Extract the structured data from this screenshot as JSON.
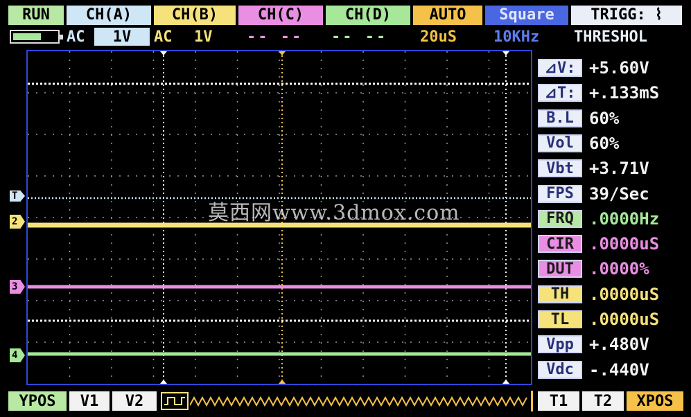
{
  "header": {
    "run": "RUN",
    "ch_a": "CH(A)",
    "ch_b": "CH(B)",
    "ch_c": "CH(C)",
    "ch_d": "CH(D)",
    "mode": "AUTO",
    "waveform": "Square",
    "trigger": "TRIGG: ⌇"
  },
  "subheader": {
    "ch_a_coupling": "AC",
    "ch_a_scale": "1V",
    "ch_b_coupling": "AC",
    "ch_b_scale": "1V",
    "ch_c_value": "-- --",
    "ch_d_value": "-- --",
    "timebase": "20uS",
    "frequency": "10KHz",
    "trigger_mode": "THRESHOL",
    "battery_level": 0.65
  },
  "measurements": [
    {
      "label": "⊿V:",
      "value": "+5.60V"
    },
    {
      "label": "⊿T:",
      "value": "+.133mS"
    },
    {
      "label": "B.L",
      "value": "60%"
    },
    {
      "label": "Vol",
      "value": "60%"
    },
    {
      "label": "Vbt",
      "value": "+3.71V"
    },
    {
      "label": "FPS",
      "value": "39/Sec"
    },
    {
      "label": "FRQ",
      "value": ".0000Hz"
    },
    {
      "label": "CIR",
      "value": ".0000uS"
    },
    {
      "label": "DUT",
      "value": ".0000%"
    },
    {
      "label": "TH",
      "value": ".0000uS"
    },
    {
      "label": "TL",
      "value": ".0000uS"
    },
    {
      "label": "Vpp",
      "value": "+.480V"
    },
    {
      "label": "Vdc",
      "value": "-.440V"
    }
  ],
  "markers": {
    "trigger": "T",
    "ch2": "2",
    "ch3": "3",
    "ch4": "4"
  },
  "footer": {
    "ypos": "YPOS",
    "v1": "V1",
    "v2": "V2",
    "t1": "T1",
    "t2": "T2",
    "xpos": "XPOS"
  },
  "watermark": "莫西网www.3dmox.com",
  "colors": {
    "ch_a": "#cfe6f7",
    "ch_b": "#f6e27a",
    "ch_c": "#e98ee3",
    "ch_d": "#a6e79a",
    "auto": "#f5c148",
    "square": "#4a66e0",
    "grid_border": "#2f47d6"
  }
}
